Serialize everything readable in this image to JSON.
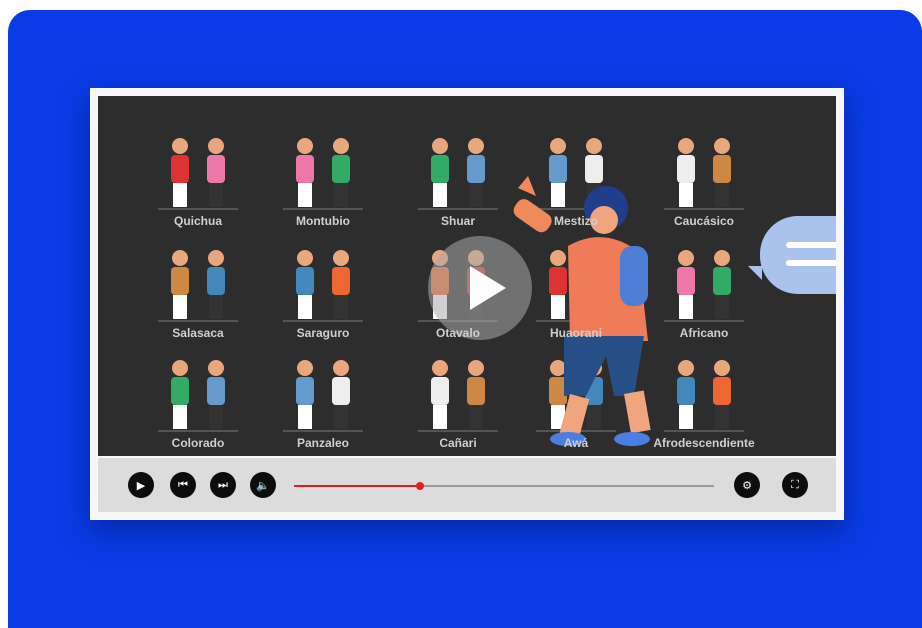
{
  "video": {
    "labels": [
      "Quichua",
      "Montubio",
      "Shuar",
      "Mestizo",
      "Caucásico",
      "Salasaca",
      "Saraguro",
      "Otavalo",
      "Huaorani",
      "Africano",
      "Colorado",
      "Panzaleo",
      "Cañari",
      "Awá",
      "Afrodescendiente"
    ],
    "progress": 0.3
  },
  "controls": {
    "play_icon": "play-icon",
    "prev_icon": "skip-previous-icon",
    "next_icon": "skip-next-icon",
    "volume_icon": "volume-icon",
    "settings_icon": "gear-icon",
    "fullscreen_icon": "fullscreen-icon"
  },
  "colors": {
    "background": "#0a3be6",
    "screen": "#2d2d2d",
    "progress": "#e02020",
    "bubble": "#a9c3ec"
  }
}
